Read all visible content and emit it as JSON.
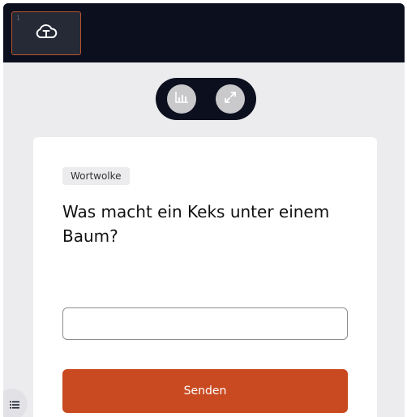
{
  "topbar": {
    "slide_thumbnail": {
      "number": "1",
      "icon": "cloud-text-icon"
    }
  },
  "toolbar": {
    "buttons": [
      {
        "icon": "bar-chart-icon"
      },
      {
        "icon": "expand-icon"
      }
    ]
  },
  "card": {
    "badge": "Wortwolke",
    "question": "Was macht ein Keks unter einem Baum?",
    "answer_placeholder": "",
    "answer_value": "",
    "submit_label": "Senden"
  },
  "sidebar_toggle": {
    "icon": "list-icon"
  },
  "colors": {
    "topbar_bg": "#0b0f1e",
    "accent": "#c94a21",
    "thumbnail_border": "#b8552b",
    "page_bg": "#ececee"
  }
}
